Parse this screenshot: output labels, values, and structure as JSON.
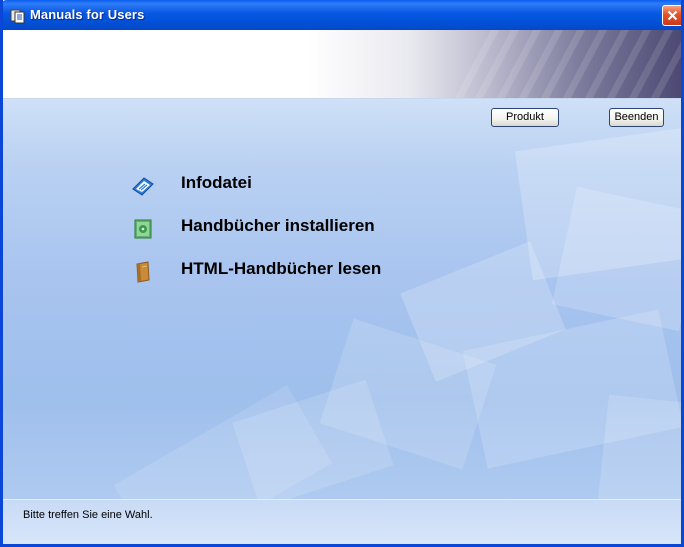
{
  "window": {
    "title": "Manuals for Users"
  },
  "toolbar": {
    "product_label": "Produkt",
    "exit_label": "Beenden"
  },
  "menu": {
    "items": [
      {
        "label": "Infodatei",
        "icon": "info-file-icon"
      },
      {
        "label": "Handbücher installieren",
        "icon": "install-manuals-icon"
      },
      {
        "label": "HTML-Handbücher lesen",
        "icon": "read-html-manuals-icon"
      }
    ]
  },
  "status": {
    "text": "Bitte treffen Sie eine Wahl."
  },
  "colors": {
    "titlebar": "#0a5fef",
    "content_background": "#a8c4ef",
    "close_button": "#e5512b"
  }
}
